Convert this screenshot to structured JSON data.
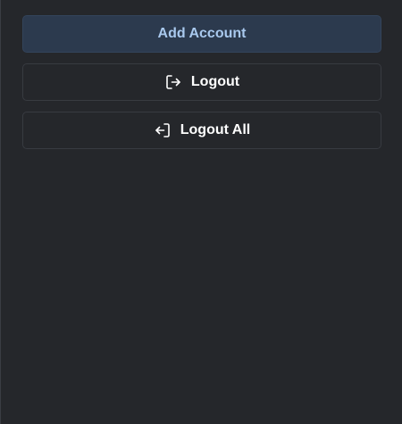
{
  "actions": {
    "add_account_label": "Add Account",
    "logout_label": "Logout",
    "logout_all_label": "Logout All",
    "logout_icon": "logout-icon",
    "logout_all_icon": "logout-all-icon"
  },
  "colors": {
    "background": "#25272b",
    "primary_button_bg": "#2c3a4e",
    "primary_button_text": "#a9c9ee",
    "outline_border": "#383b41",
    "text": "#ffffff"
  }
}
